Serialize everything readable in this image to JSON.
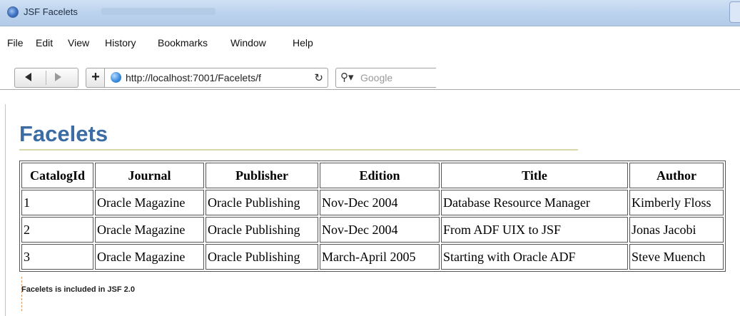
{
  "window": {
    "title": "JSF Facelets"
  },
  "menu": {
    "items": [
      "File",
      "Edit",
      "View",
      "History",
      "Bookmarks",
      "Window",
      "Help"
    ]
  },
  "toolbar": {
    "new_tab_label": "+",
    "url": "http://localhost:7001/Facelets/f",
    "search_placeholder": "Google"
  },
  "page": {
    "heading": "Facelets",
    "footer_note": "Facelets is included in JSF 2.0"
  },
  "table": {
    "headers": [
      "CatalogId",
      "Journal",
      "Publisher",
      "Edition",
      "Title",
      "Author"
    ],
    "rows": [
      [
        "1",
        "Oracle Magazine",
        "Oracle Publishing",
        "Nov-Dec 2004",
        "Database Resource Manager",
        "Kimberly Floss"
      ],
      [
        "2",
        "Oracle Magazine",
        "Oracle Publishing",
        "Nov-Dec 2004",
        "From ADF UIX to JSF",
        "Jonas Jacobi"
      ],
      [
        "3",
        "Oracle Magazine",
        "Oracle Publishing",
        "March-April 2005",
        "Starting with Oracle ADF",
        "Steve Muench"
      ]
    ]
  },
  "icons": {
    "browser": "firefox-icon",
    "back": "back-arrow-icon",
    "forward": "forward-arrow-icon",
    "site": "globe-icon",
    "reload": "reload-icon",
    "search": "search-icon"
  },
  "colors": {
    "heading": "#3b6ca3",
    "heading_rule": "#d9d6a8"
  }
}
